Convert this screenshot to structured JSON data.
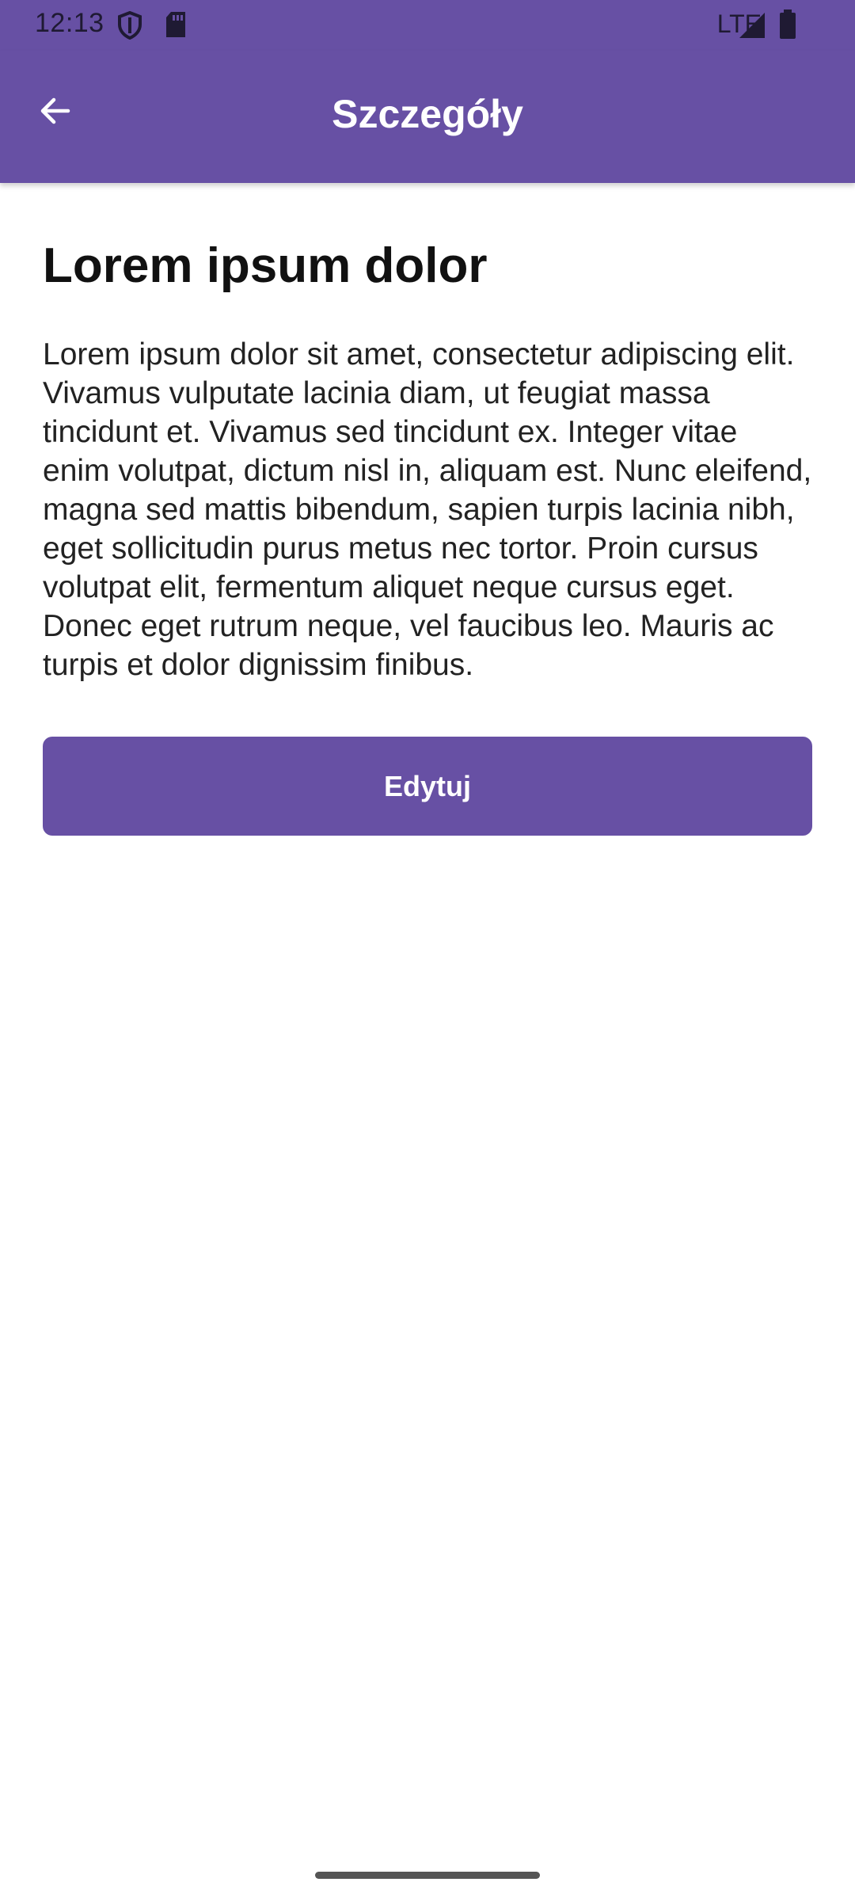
{
  "status_bar": {
    "time": "12:13",
    "network": "LTE",
    "icons": [
      "shield-icon",
      "sd-card-icon",
      "signal-icon",
      "battery-icon"
    ]
  },
  "app_bar": {
    "title": "Szczegóły",
    "back_icon": "arrow-back-icon"
  },
  "content": {
    "headline": "Lorem ipsum dolor",
    "body": "Lorem ipsum dolor sit amet, consectetur adipiscing elit. Vivamus vulputate lacinia diam, ut feugiat massa tincidunt et. Vivamus sed tincidunt ex. Integer vitae enim volutpat, dictum nisl in, aliquam est. Nunc eleifend, magna sed mattis bibendum, sapien turpis lacinia nibh, eget sollicitudin purus metus nec tortor. Proin cursus volutpat elit, fermentum aliquet neque cursus eget. Donec eget rutrum neque, vel faucibus leo. Mauris ac turpis et dolor dignissim finibus.",
    "edit_label": "Edytuj"
  },
  "colors": {
    "primary": "#6750a4",
    "on_primary": "#ffffff",
    "background": "#ffffff",
    "text": "#222222"
  }
}
